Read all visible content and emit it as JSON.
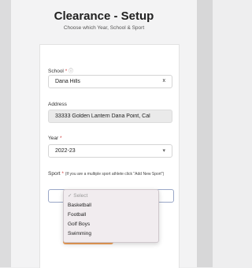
{
  "header": {
    "title": "Clearance - Setup",
    "subtitle": "Choose which Year, School & Sport"
  },
  "school": {
    "label": "School",
    "required_mark": "*",
    "help_icon": "question-circle-icon",
    "value": "Dana Hills",
    "clear": "x"
  },
  "address": {
    "label": "Address",
    "value": "33333 Golden Lantern Dana Point, Cal"
  },
  "year": {
    "label": "Year",
    "required_mark": "*",
    "value": "2022-23",
    "chevron": "▾"
  },
  "sport": {
    "label": "Sport",
    "required_mark": "*",
    "note": "(If you are a multiple sport athlete click \"Add New Sport\")",
    "options": {
      "placeholder": "✓ Select",
      "items": [
        "Basketball",
        "Football",
        "Golf Boys",
        "Swimming"
      ]
    }
  },
  "colors": {
    "submit_accent": "#f2a25a",
    "required": "#d04040"
  }
}
